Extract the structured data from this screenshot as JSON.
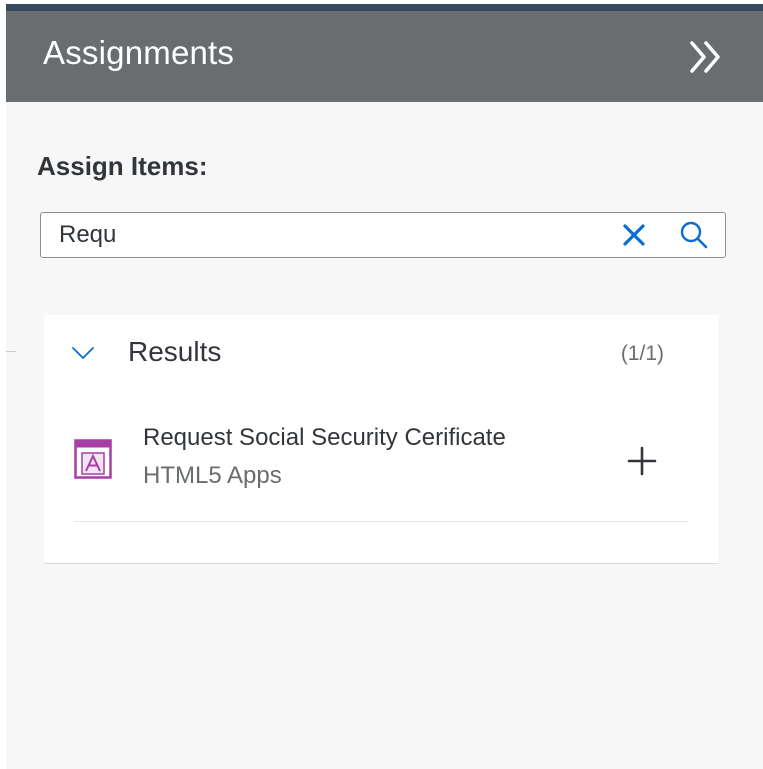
{
  "panel": {
    "title": "Assignments",
    "expand_icon": "double-chevron-right-icon"
  },
  "assign": {
    "label": "Assign Items:"
  },
  "search": {
    "value": "Requ",
    "clear_icon": "close-icon",
    "search_icon": "search-icon"
  },
  "results": {
    "title": "Results",
    "count": "(1/1)",
    "toggle_icon": "chevron-down-icon",
    "items": [
      {
        "title": "Request Social Security Cerificate",
        "subtitle": "HTML5 Apps",
        "icon": "html5-app-icon",
        "action_icon": "add-icon"
      }
    ]
  },
  "colors": {
    "header_bg": "#6a6d70",
    "top_strip": "#354a5f",
    "accent": "#0a6ed1",
    "icon_magenta": "#a63fa3",
    "text_primary": "#32363a",
    "text_secondary": "#6a6d70"
  }
}
